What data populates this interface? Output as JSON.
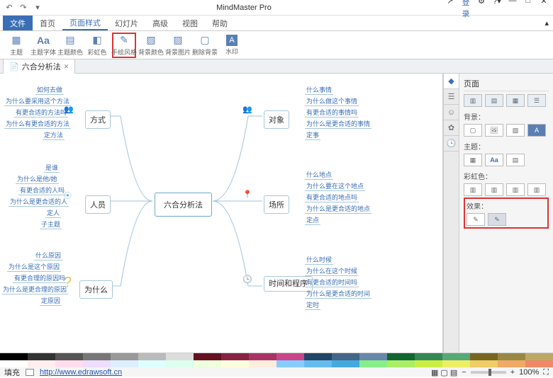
{
  "app": {
    "title": "MindMaster Pro"
  },
  "titlebar": {
    "login": "登录"
  },
  "menu": {
    "file": "文件",
    "items": [
      "首页",
      "页面样式",
      "幻灯片",
      "高级",
      "视图",
      "帮助"
    ],
    "active": 1
  },
  "ribbon": {
    "items": [
      {
        "label": "主题",
        "icon": "▦"
      },
      {
        "label": "主题字体",
        "icon": "Aa"
      },
      {
        "label": "主题颜色",
        "icon": "▤"
      },
      {
        "label": "彩虹色",
        "icon": "◧"
      },
      {
        "label": "手绘风格",
        "icon": "✎",
        "hl": true
      },
      {
        "label": "背景颜色",
        "icon": "▧"
      },
      {
        "label": "背景图片",
        "icon": "▨"
      },
      {
        "label": "删除背景",
        "icon": "▢"
      },
      {
        "label": "水印",
        "icon": "A"
      }
    ]
  },
  "doctab": {
    "name": "六合分析法"
  },
  "mindmap": {
    "center": "六合分析法",
    "branches": [
      {
        "title": "方式",
        "leaves": [
          "如何去做",
          "为什么要采用这个方法",
          "有更合适的方法吗",
          "为什么有更合适的方法",
          "定方法"
        ]
      },
      {
        "title": "人员",
        "leaves": [
          "是谁",
          "为什么是他/她",
          "有更合适的人吗",
          "为什么是更合适的人",
          "定人",
          "子主题"
        ]
      },
      {
        "title": "为什么",
        "leaves": [
          "什么原因",
          "为什么是这个原因",
          "有更合理的原因吗",
          "为什么是更合理的原因",
          "定原因"
        ]
      },
      {
        "title": "对象",
        "leaves": [
          "什么事情",
          "为什么做这个事情",
          "有更合适的事情吗",
          "为什么是更合适的事情",
          "定事"
        ]
      },
      {
        "title": "场所",
        "leaves": [
          "什么地点",
          "为什么要在这个地点",
          "有更合适的地点吗",
          "为什么是更合适的地点",
          "定点"
        ]
      },
      {
        "title": "时间和程序",
        "leaves": [
          "什么时候",
          "为什么在这个时候",
          "有更合适的时间吗",
          "为什么是更合适的时间",
          "定时"
        ]
      }
    ]
  },
  "side": {
    "title": "页面",
    "sections": {
      "bg": "背景：",
      "theme": "主题：",
      "rainbow": "彩虹色：",
      "effect": "效果："
    }
  },
  "status": {
    "fill": "填充",
    "url": "http://www.edrawsoft.cn",
    "zoom": "100%"
  }
}
